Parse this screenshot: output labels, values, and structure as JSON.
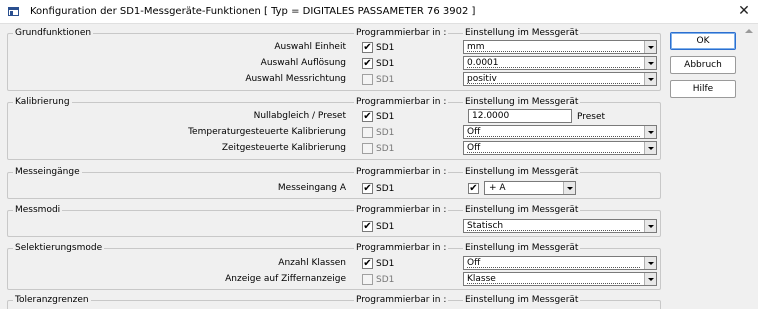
{
  "window": {
    "title": "Konfiguration der SD1-Messgeräte-Funktionen   [ Typ = DIGITALES PASSAMETER 76 3902 ]",
    "close": "✕"
  },
  "common": {
    "prog_label": "Programmierbar in :",
    "setting_label": "Einstellung im Messgerät",
    "sd1": "SD1",
    "check": "✔"
  },
  "groups": {
    "grund": {
      "title": "Grundfunktionen",
      "rows": [
        {
          "label": "Auswahl Einheit",
          "checked": true,
          "value": "mm"
        },
        {
          "label": "Auswahl Auflösung",
          "checked": true,
          "value": "0.0001"
        },
        {
          "label": "Auswahl Messrichtung",
          "checked": false,
          "value": "positiv"
        }
      ]
    },
    "kalib": {
      "title": "Kalibrierung",
      "rows": [
        {
          "label": "Nullabgleich / Preset",
          "checked": true,
          "value": "12.0000",
          "suffix": "Preset"
        },
        {
          "label": "Temperaturgesteuerte Kalibrierung",
          "checked": false,
          "value": "Off"
        },
        {
          "label": "Zeitgesteuerte Kalibrierung",
          "checked": false,
          "value": "Off"
        }
      ]
    },
    "messein": {
      "title": "Messeingänge",
      "rows": [
        {
          "label": "Messeingang A",
          "checked": true,
          "value": "+ A"
        }
      ]
    },
    "messmodi": {
      "title": "Messmodi",
      "rows": [
        {
          "label": "",
          "checked": true,
          "value": "Statisch"
        }
      ]
    },
    "selekt": {
      "title": "Selektierungsmode",
      "rows": [
        {
          "label": "Anzahl Klassen",
          "checked": true,
          "value": "Off"
        },
        {
          "label": "Anzeige auf Ziffernanzeige",
          "checked": false,
          "value": "Klasse"
        }
      ]
    },
    "toleranz": {
      "title": "Toleranzgrenzen"
    }
  },
  "buttons": {
    "ok": "OK",
    "abbruch": "Abbruch",
    "hilfe": "Hilfe"
  }
}
